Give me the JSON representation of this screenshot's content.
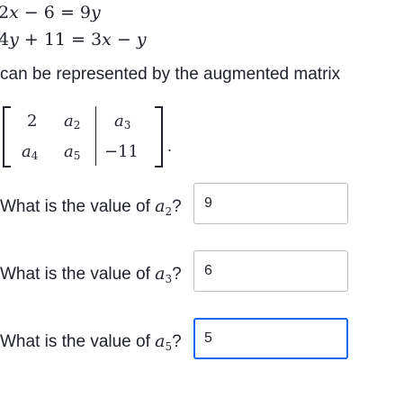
{
  "equations": {
    "eq1": {
      "a": "2",
      "b": "x",
      "c": " − 6 = 9",
      "d": "y"
    },
    "eq2": {
      "a": "4",
      "b": "y",
      "c": " + 11 = 3",
      "d": "x",
      "e": " − ",
      "f": "y"
    }
  },
  "intro_text": "can be represented by the augmented matrix",
  "matrix": {
    "r1c1": "2",
    "r1c2_var": "a",
    "r1c2_sub": "2",
    "r1c3_var": "a",
    "r1c3_sub": "3",
    "r2c1_var": "a",
    "r2c1_sub": "4",
    "r2c2_var": "a",
    "r2c2_sub": "5",
    "r2c3": "−11",
    "terminator": "."
  },
  "questions": [
    {
      "prefix": "What is the value of ",
      "var": "a",
      "sub": "2",
      "suffix": "?",
      "answer": "9"
    },
    {
      "prefix": "What is the value of ",
      "var": "a",
      "sub": "3",
      "suffix": "?",
      "answer": "6"
    },
    {
      "prefix": "What is the value of ",
      "var": "a",
      "sub": "5",
      "suffix": "?",
      "answer": "5"
    }
  ]
}
